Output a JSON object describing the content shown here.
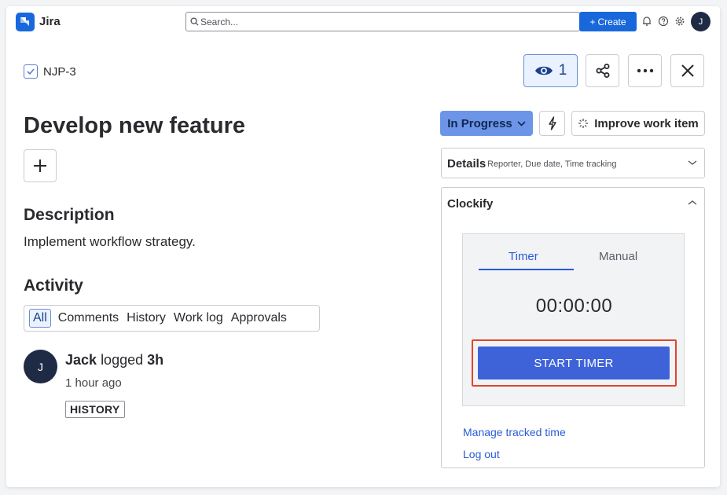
{
  "app": {
    "name": "Jira"
  },
  "topbar": {
    "search_placeholder": "Search...",
    "create_label": "Create",
    "avatar_initial": "J"
  },
  "issue": {
    "key": "NJP-3",
    "watch_count": "1",
    "title": "Develop new feature",
    "description_heading": "Description",
    "description": "Implement workflow strategy.",
    "activity_heading": "Activity"
  },
  "activity": {
    "tabs": [
      "All",
      "Comments",
      "History",
      "Work log",
      "Approvals"
    ],
    "active_tab": "All",
    "entry": {
      "avatar_initial": "J",
      "user": "Jack",
      "action": "logged",
      "amount": "3h",
      "time": "1 hour ago",
      "badge": "HISTORY"
    }
  },
  "sidebar": {
    "status": "In Progress",
    "improve_label": "Improve work item",
    "details_title": "Details",
    "details_sub": "Reporter, Due date, Time tracking",
    "clockify": {
      "title": "Clockify",
      "tab_timer": "Timer",
      "tab_manual": "Manual",
      "time": "00:00:00",
      "start_label": "START TIMER",
      "manage_link": "Manage tracked time",
      "logout_link": "Log out"
    }
  },
  "colors": {
    "brand": "#1868db",
    "status_bg": "#6c95e8",
    "start_btn": "#3e63d8",
    "highlight": "#e0452f"
  }
}
